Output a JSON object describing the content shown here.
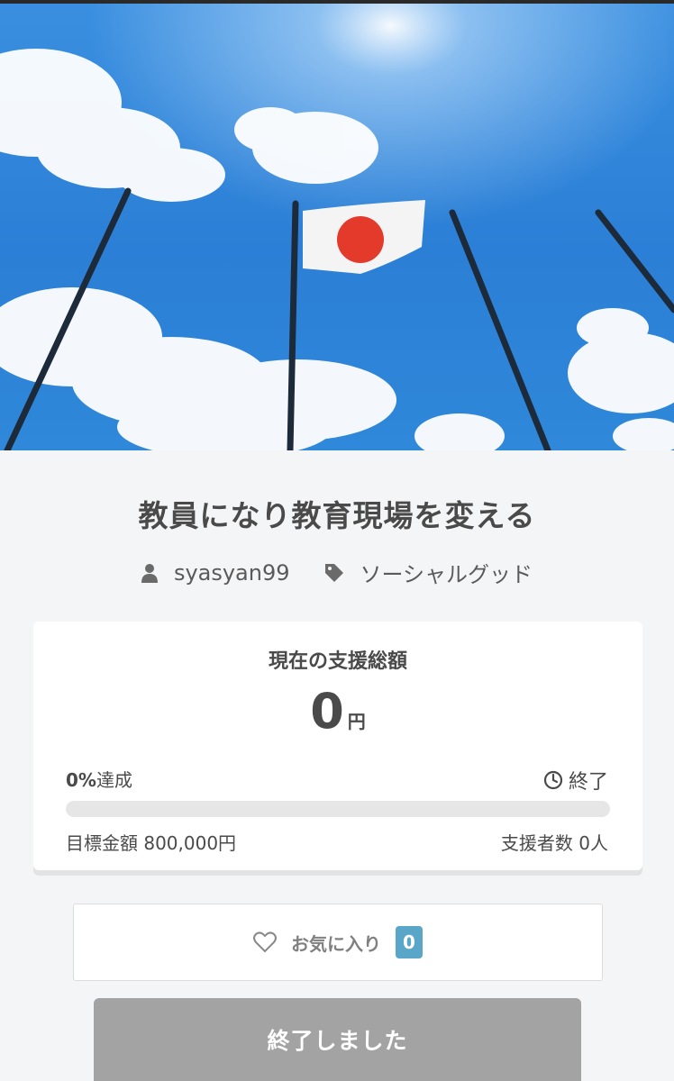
{
  "project": {
    "title": "教員になり教育現場を変える",
    "author": "syasyan99",
    "category": "ソーシャルグッド"
  },
  "funding": {
    "label": "現在の支援総額",
    "amount": "0",
    "currency": "円",
    "achievement": "0%",
    "achievement_suffix": "達成",
    "progress_fraction": 0,
    "status": "終了",
    "goal": "目標金額 800,000円",
    "backers": "支援者数 0人"
  },
  "favorite": {
    "label": "お気に入り",
    "count": "0"
  },
  "cta": {
    "label": "終了しました"
  },
  "colors": {
    "accent": "#5aa6c9",
    "disabled_button": "#a3a3a3",
    "sky": "#2a86d8"
  },
  "icons": {
    "author": "user-icon",
    "category": "tag-icon",
    "status": "clock-icon",
    "favorite": "heart-outline-icon"
  }
}
